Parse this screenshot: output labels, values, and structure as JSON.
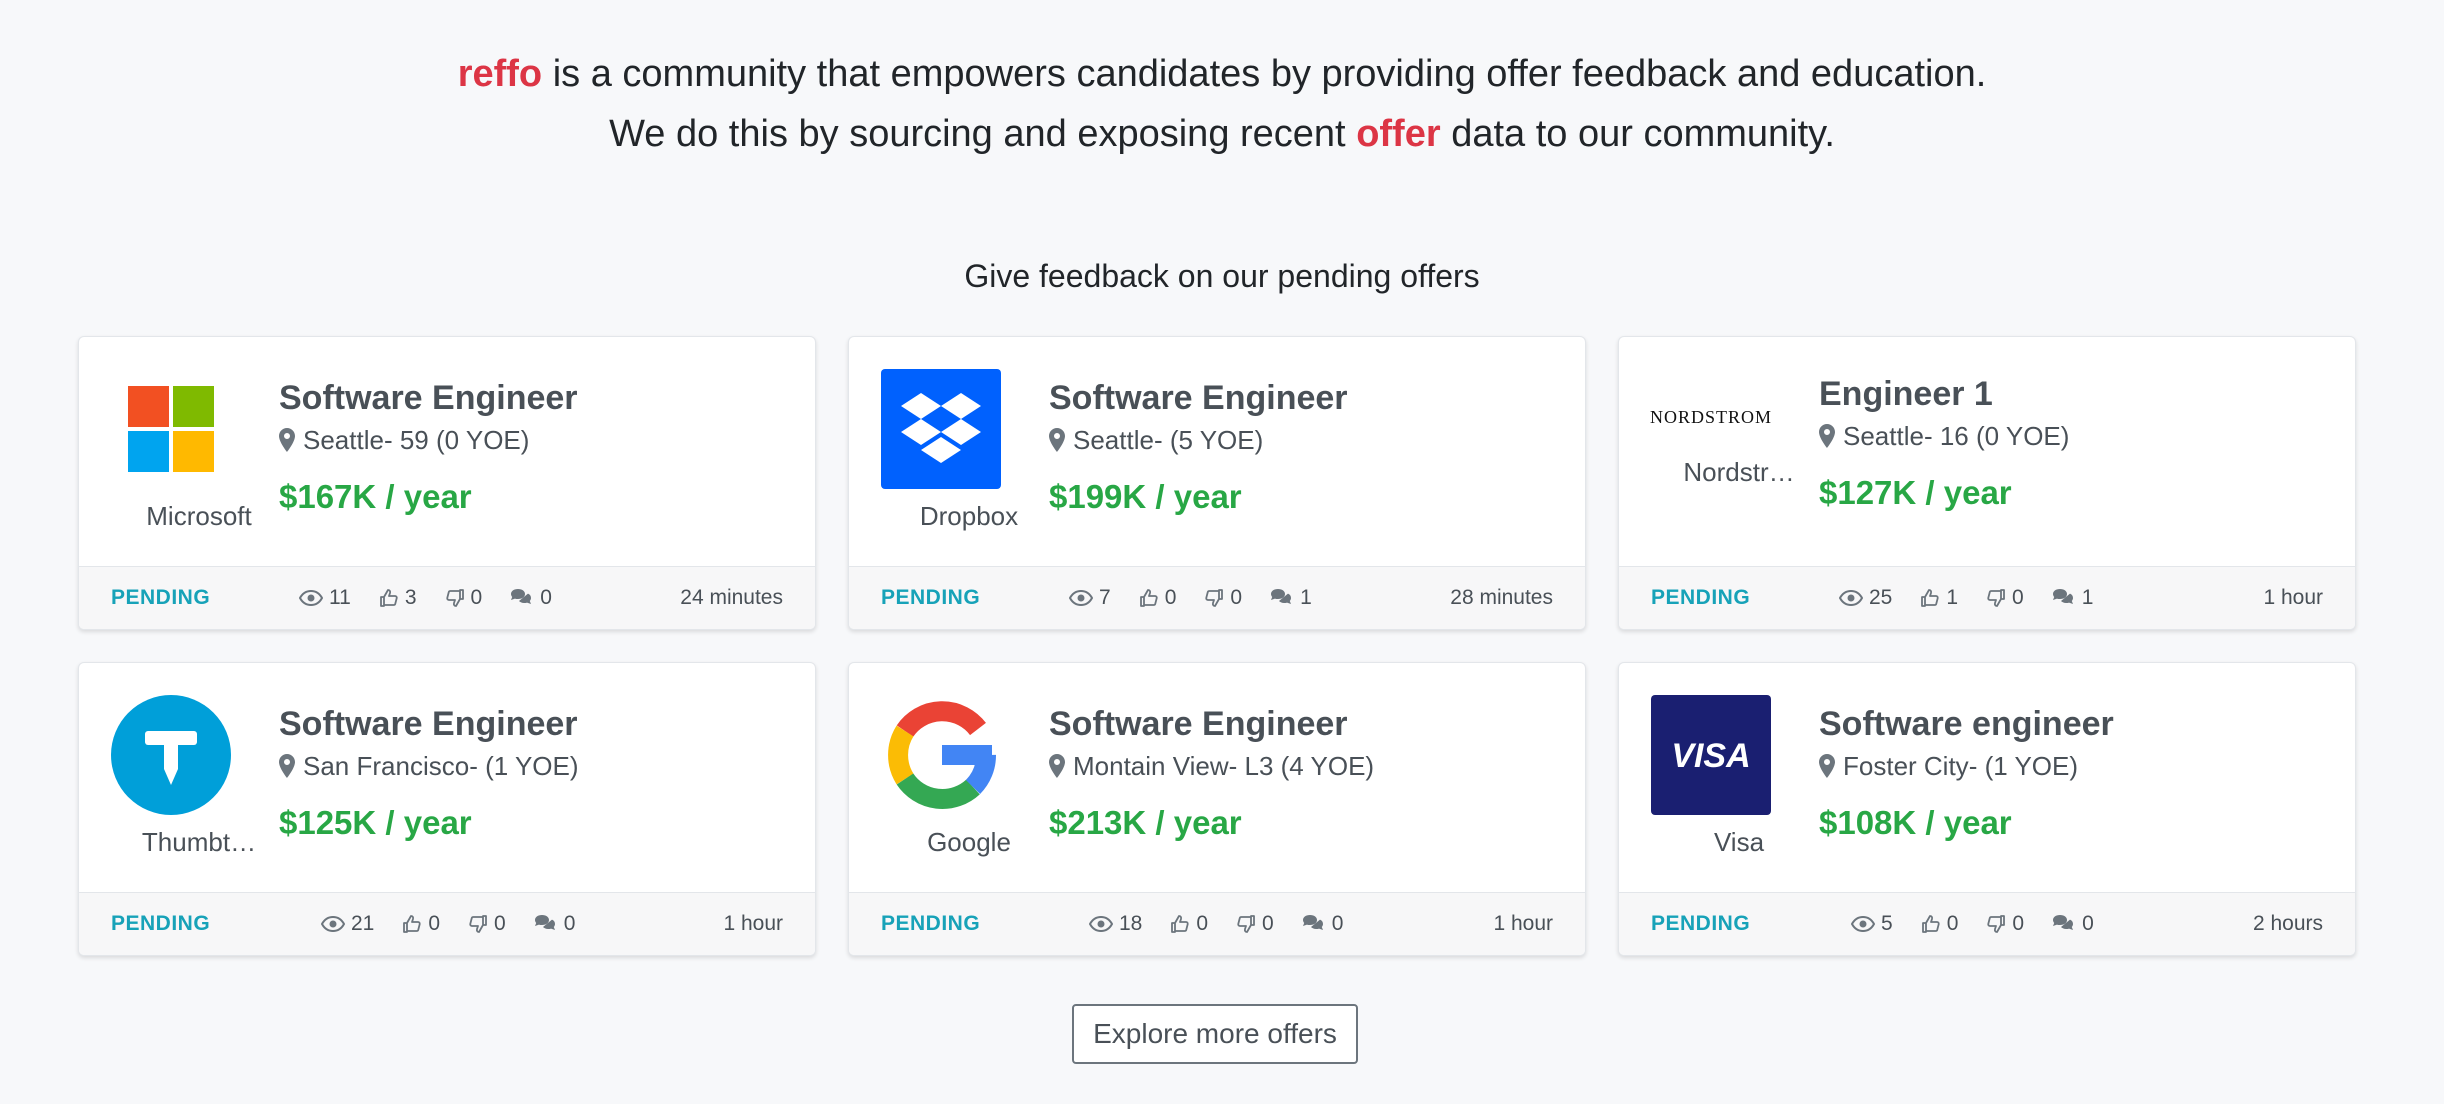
{
  "intro": {
    "brand": "reffo",
    "line1_rest": " is a community that empowers candidates by providing offer feedback and education.",
    "line2_pre": "We do this by sourcing and exposing recent ",
    "line2_highlight": "offer",
    "line2_post": " data to our community."
  },
  "section_title": "Give feedback on our pending offers",
  "colors": {
    "accent": "#dc3545",
    "salary": "#28a745",
    "status": "#17a2b8"
  },
  "offers": [
    {
      "company": "Microsoft",
      "logo": "microsoft-logo",
      "title": "Software Engineer",
      "location": "Seattle",
      "level": " - 59 (0 YOE)",
      "salary": "$167K / year",
      "status": "PENDING",
      "views": "11",
      "likes": "3",
      "dislikes": "0",
      "comments": "0",
      "time": "24 minutes"
    },
    {
      "company": "Dropbox",
      "logo": "dropbox-logo",
      "title": "Software Engineer",
      "location": "Seattle",
      "level": " - (5 YOE)",
      "salary": "$199K / year",
      "status": "PENDING",
      "views": "7",
      "likes": "0",
      "dislikes": "0",
      "comments": "1",
      "time": "28 minutes"
    },
    {
      "company": "Nordstr…",
      "logo_text": "NORDSTROM",
      "logo": "nordstrom-logo",
      "title": "Engineer 1",
      "location": "Seattle",
      "level": " - 16 (0 YOE)",
      "salary": "$127K / year",
      "status": "PENDING",
      "views": "25",
      "likes": "1",
      "dislikes": "0",
      "comments": "1",
      "time": "1 hour"
    },
    {
      "company": "Thumbt…",
      "logo": "thumbtack-logo",
      "title": "Software Engineer",
      "location": "San Francisco",
      "level": " - (1 YOE)",
      "salary": "$125K / year",
      "status": "PENDING",
      "views": "21",
      "likes": "0",
      "dislikes": "0",
      "comments": "0",
      "time": "1 hour"
    },
    {
      "company": "Google",
      "logo": "google-logo",
      "title": "Software Engineer",
      "location": "Montain View",
      "level": " - L3 (4 YOE)",
      "salary": "$213K / year",
      "status": "PENDING",
      "views": "18",
      "likes": "0",
      "dislikes": "0",
      "comments": "0",
      "time": "1 hour"
    },
    {
      "company": "Visa",
      "logo_text": "VISA",
      "logo": "visa-logo",
      "title": "Software engineer",
      "location": "Foster City",
      "level": " - (1 YOE)",
      "salary": "$108K / year",
      "status": "PENDING",
      "views": "5",
      "likes": "0",
      "dislikes": "0",
      "comments": "0",
      "time": "2 hours"
    }
  ],
  "explore_label": "Explore more offers"
}
